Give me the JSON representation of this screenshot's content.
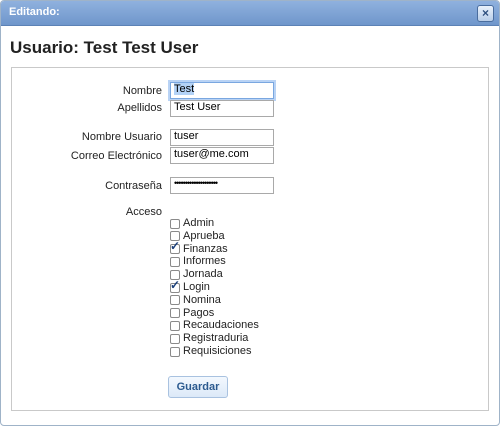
{
  "dialog": {
    "title": "Editando:",
    "close_icon": "close-icon",
    "heading": "Usuario: Test Test User"
  },
  "form": {
    "nombre": {
      "label": "Nombre",
      "value": "Test"
    },
    "apellidos": {
      "label": "Apellidos",
      "value": "Test User"
    },
    "nombre_usuario": {
      "label": "Nombre Usuario",
      "value": "tuser"
    },
    "correo": {
      "label": "Correo Electrónico",
      "value": "tuser@me.com"
    },
    "contrasena": {
      "label": "Contraseña",
      "value": "••••••••••••••••••••"
    },
    "acceso": {
      "label": "Acceso",
      "options": [
        {
          "label": "Admin",
          "checked": false
        },
        {
          "label": "Aprueba",
          "checked": false
        },
        {
          "label": "Finanzas",
          "checked": true
        },
        {
          "label": "Informes",
          "checked": false
        },
        {
          "label": "Jornada",
          "checked": false
        },
        {
          "label": "Login",
          "checked": true
        },
        {
          "label": "Nomina",
          "checked": false
        },
        {
          "label": "Pagos",
          "checked": false
        },
        {
          "label": "Recaudaciones",
          "checked": false
        },
        {
          "label": "Registraduria",
          "checked": false
        },
        {
          "label": "Requisiciones",
          "checked": false
        }
      ]
    },
    "submit_label": "Guardar"
  },
  "colors": {
    "titlebar": "#7fa4d6",
    "accent": "#2c5a8f",
    "check": "#1b3f7a"
  }
}
